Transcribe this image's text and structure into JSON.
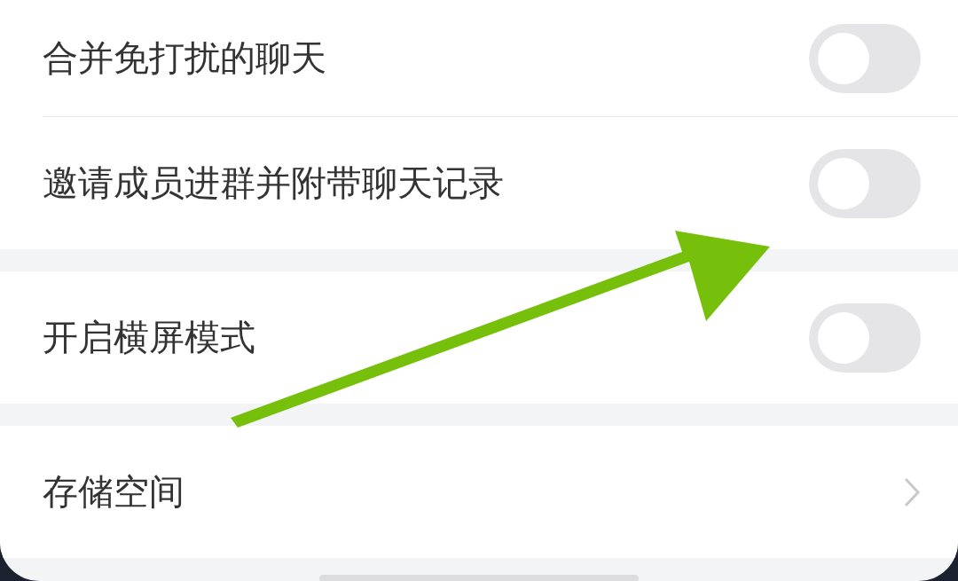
{
  "sections": [
    {
      "items": [
        {
          "kind": "toggle",
          "label": "合并免打扰的聊天",
          "on": false
        },
        {
          "kind": "toggle",
          "label": "邀请成员进群并附带聊天记录",
          "on": false
        }
      ]
    },
    {
      "items": [
        {
          "kind": "toggle",
          "label": "开启横屏模式",
          "on": false
        }
      ]
    },
    {
      "items": [
        {
          "kind": "link",
          "label": "存储空间"
        }
      ]
    }
  ]
}
